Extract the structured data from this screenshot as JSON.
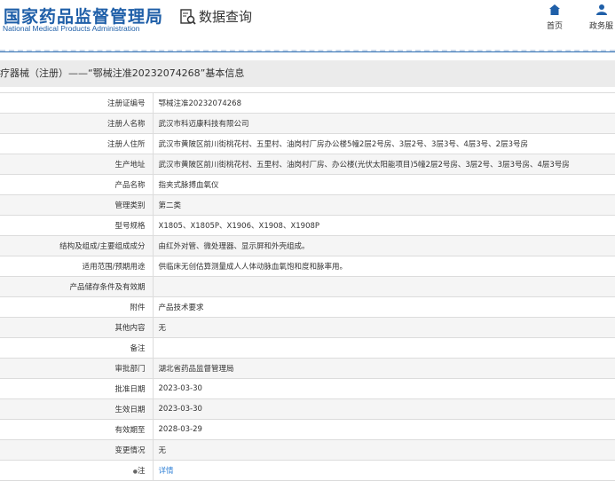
{
  "header": {
    "logo_cn": "国家药品监督管理局",
    "logo_en": "National Medical Products Administration",
    "query_label": "数据查询",
    "nav": [
      {
        "label": "首页",
        "icon": "home-icon"
      },
      {
        "label": "政务服",
        "icon": "user-icon"
      }
    ]
  },
  "title": "疗器械（注册）——“鄂械注准20232074268”基本信息",
  "rows": [
    {
      "label": "注册证编号",
      "value": "鄂械注准20232074268"
    },
    {
      "label": "注册人名称",
      "value": "武汉市科迈康科技有限公司"
    },
    {
      "label": "注册人住所",
      "value": "武汉市黄陂区前川街桃花村、五里村、油岗村厂房办公楼5幢2层2号房、3层2号、3层3号、4层3号、2层3号房"
    },
    {
      "label": "生产地址",
      "value": "武汉市黄陂区前川街桃花村、五里村、油岗村厂房、办公楼(光伏太阳能项目)5幢2层2号房、3层2号、3层3号房、4层3号房"
    },
    {
      "label": "产品名称",
      "value": "指夹式脉搏血氧仪"
    },
    {
      "label": "管理类别",
      "value": "第二类"
    },
    {
      "label": "型号规格",
      "value": "X1805、X1805P、X1906、X1908、X1908P"
    },
    {
      "label": "结构及组成/主要组成成分",
      "value": "由红外对管、微处理器、显示屏和外壳组成。"
    },
    {
      "label": "适用范围/预期用途",
      "value": "供临床无创估算测量成人人体动脉血氧饱和度和脉率用。"
    },
    {
      "label": "产品储存条件及有效期",
      "value": ""
    },
    {
      "label": "附件",
      "value": "产品技术要求"
    },
    {
      "label": "其他内容",
      "value": "无"
    },
    {
      "label": "备注",
      "value": ""
    },
    {
      "label": "审批部门",
      "value": "湖北省药品监督管理局"
    },
    {
      "label": "批准日期",
      "value": "2023-03-30"
    },
    {
      "label": "生效日期",
      "value": "2023-03-30"
    },
    {
      "label": "有效期至",
      "value": "2028-03-29"
    },
    {
      "label": "变更情况",
      "value": "无"
    },
    {
      "label": "注",
      "value": "详情",
      "link": true
    }
  ]
}
